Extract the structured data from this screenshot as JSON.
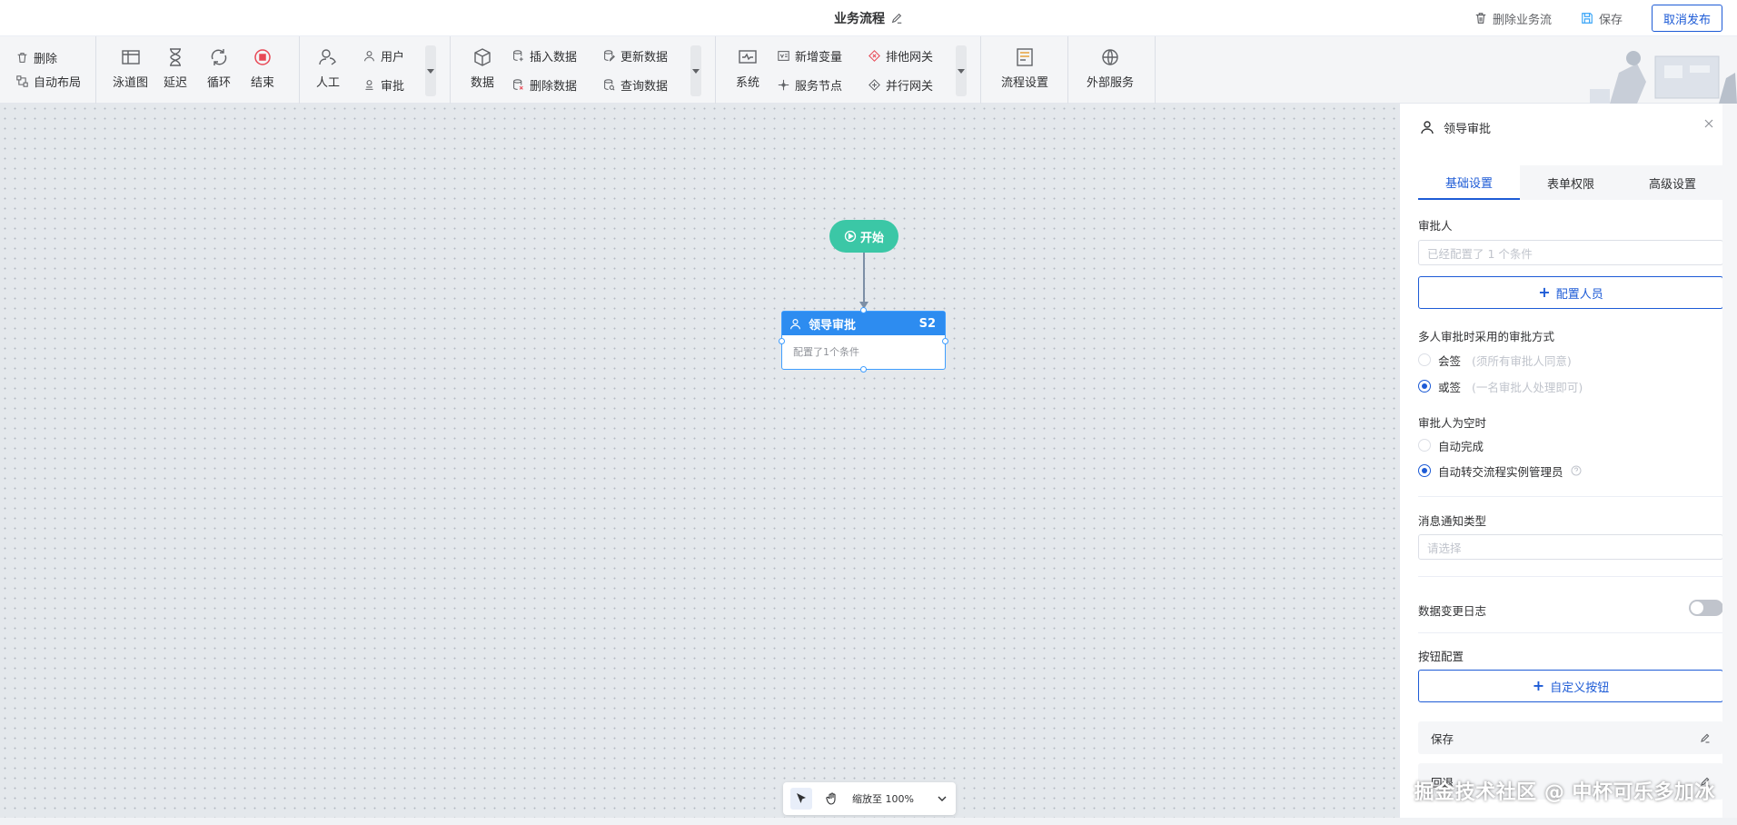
{
  "header": {
    "title": "业务流程",
    "delete_flow_label": "删除业务流",
    "save_label": "保存",
    "cancel_publish_label": "取消发布"
  },
  "toolbar": {
    "edit": {
      "delete_label": "删除",
      "auto_layout_label": "自动布局"
    },
    "basic": {
      "swimlane_label": "泳道图",
      "delay_label": "延迟",
      "loop_label": "循环",
      "end_label": "结束"
    },
    "manual": {
      "manual_label": "人工",
      "user_label": "用户",
      "approval_label": "审批"
    },
    "data": {
      "data_label": "数据",
      "insert_label": "插入数据",
      "update_label": "更新数据",
      "delete_label": "删除数据",
      "query_label": "查询数据"
    },
    "system": {
      "system_label": "系统",
      "new_var_label": "新增变量",
      "exclusive_gateway_label": "排他网关",
      "service_node_label": "服务节点",
      "parallel_gateway_label": "并行网关"
    },
    "settings": {
      "flow_settings_label": "流程设置"
    },
    "external": {
      "external_service_label": "外部服务"
    }
  },
  "canvas": {
    "start_node": {
      "label": "开始"
    },
    "task_node": {
      "title": "领导审批",
      "code": "S2",
      "body": "配置了1个条件"
    },
    "zoom": {
      "text": "缩放至 100%"
    }
  },
  "panel": {
    "title": "领导审批",
    "tabs": [
      {
        "label": "基础设置",
        "active": true
      },
      {
        "label": "表单权限",
        "active": false
      },
      {
        "label": "高级设置",
        "active": false
      }
    ],
    "approver": {
      "label": "审批人",
      "placeholder": "已经配置了 1 个条件",
      "config_button_label": "配置人员"
    },
    "multi_mode": {
      "label": "多人审批时采用的审批方式",
      "options": [
        {
          "label": "会签",
          "hint": "(须所有审批人同意)",
          "checked": false
        },
        {
          "label": "或签",
          "hint": "(一名审批人处理即可)",
          "checked": true
        }
      ]
    },
    "empty_approver": {
      "label": "审批人为空时",
      "options": [
        {
          "label": "自动完成",
          "checked": false
        },
        {
          "label": "自动转交流程实例管理员",
          "checked": true
        }
      ]
    },
    "notify": {
      "label": "消息通知类型",
      "placeholder": "请选择"
    },
    "change_log": {
      "label": "数据变更日志",
      "enabled": false
    },
    "button_config": {
      "label": "按钮配置",
      "custom_button_label": "自定义按钮",
      "rows": [
        {
          "label": "保存"
        },
        {
          "label": "回退"
        }
      ]
    }
  },
  "watermark": {
    "text": "掘金技术社区 @ 中杯可乐多加冰"
  },
  "colors": {
    "primary": "#1d5bd6",
    "node_blue": "#2d8cf0",
    "start_green": "#3bc7a6",
    "canvas_bg": "#e4e8ec"
  }
}
